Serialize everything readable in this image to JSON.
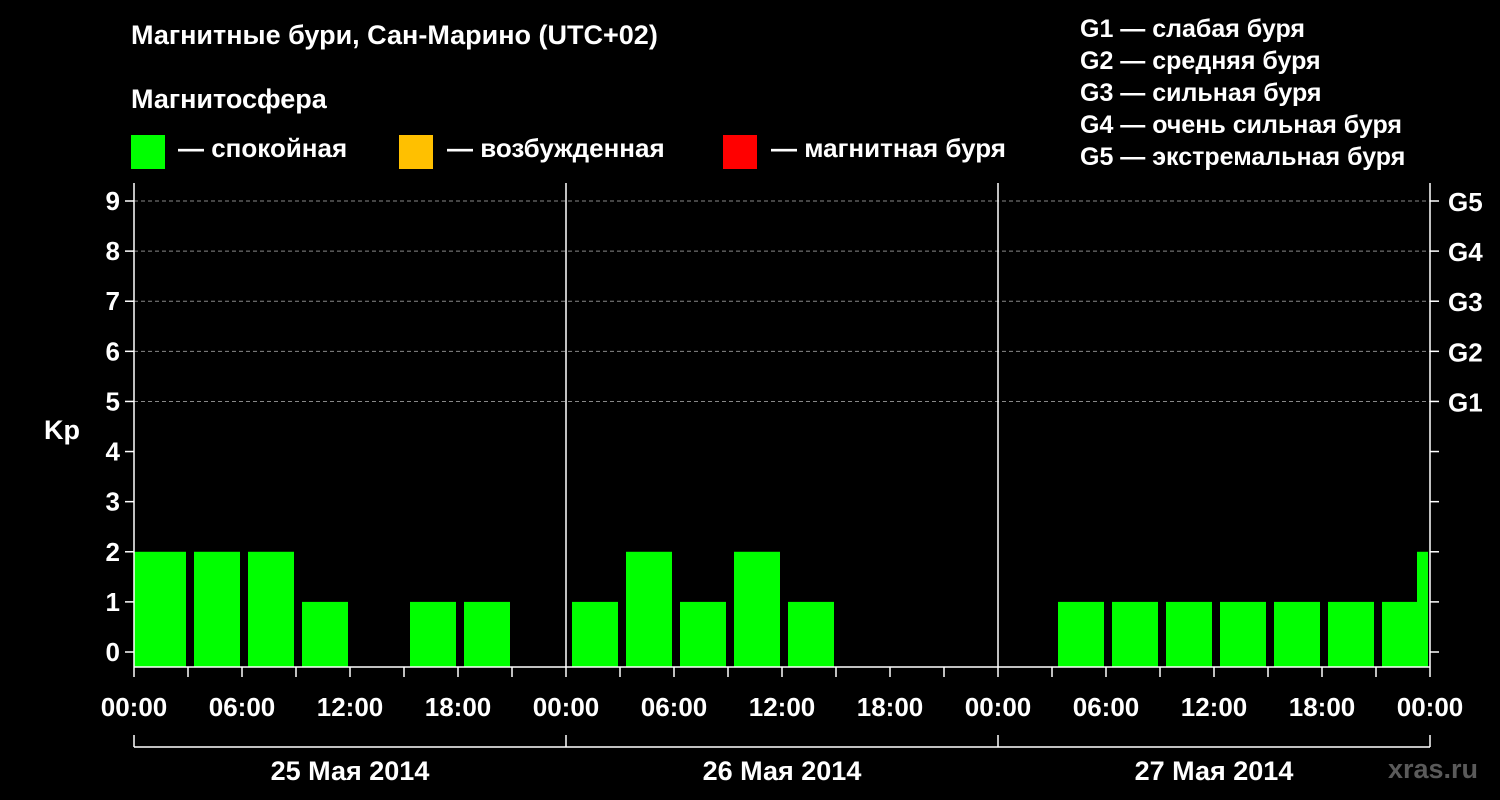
{
  "header": {
    "title": "Магнитные бури, Сан-Марино (UTC+02)",
    "magnetosphere_label": "Магнитосфера",
    "watermark": "xras.ru"
  },
  "legend": [
    {
      "label": "— спокойная",
      "color": "#00ff00"
    },
    {
      "label": "— возбужденная",
      "color": "#ffc000"
    },
    {
      "label": "— магнитная буря",
      "color": "#ff0000"
    }
  ],
  "g_scale": [
    "G1 — слабая буря",
    "G2 — средняя буря",
    "G3 — сильная буря",
    "G4 — очень сильная буря",
    "G5 — экстремальная буря"
  ],
  "chart_data": {
    "type": "bar",
    "ylabel": "Kp",
    "ylim": [
      0,
      9
    ],
    "y_ticks": [
      0,
      1,
      2,
      3,
      4,
      5,
      6,
      7,
      8,
      9
    ],
    "right_axis": [
      {
        "kp": 5,
        "label": "G1"
      },
      {
        "kp": 6,
        "label": "G2"
      },
      {
        "kp": 7,
        "label": "G3"
      },
      {
        "kp": 8,
        "label": "G4"
      },
      {
        "kp": 9,
        "label": "G5"
      }
    ],
    "x_tick_labels": [
      "00:00",
      "06:00",
      "12:00",
      "18:00",
      "00:00",
      "06:00",
      "12:00",
      "18:00",
      "00:00",
      "06:00",
      "12:00",
      "18:00",
      "00:00"
    ],
    "days": [
      "25 Мая 2014",
      "26 Мая 2014",
      "27 Мая 2014"
    ],
    "grid": "horizontal dashed lines at Kp 5-9",
    "interval_hours": 3,
    "bars": [
      {
        "start_hour": 0,
        "kp": 2
      },
      {
        "start_hour": 3,
        "kp": 2
      },
      {
        "start_hour": 6,
        "kp": 2
      },
      {
        "start_hour": 9,
        "kp": 1
      },
      {
        "start_hour": 12,
        "kp": 0
      },
      {
        "start_hour": 15,
        "kp": 1
      },
      {
        "start_hour": 18,
        "kp": 1
      },
      {
        "start_hour": 21,
        "kp": 0
      },
      {
        "start_hour": 24,
        "kp": 1
      },
      {
        "start_hour": 27,
        "kp": 2
      },
      {
        "start_hour": 30,
        "kp": 1
      },
      {
        "start_hour": 33,
        "kp": 2
      },
      {
        "start_hour": 36,
        "kp": 1
      },
      {
        "start_hour": 39,
        "kp": 0
      },
      {
        "start_hour": 42,
        "kp": 0
      },
      {
        "start_hour": 45,
        "kp": 0
      },
      {
        "start_hour": 48,
        "kp": 0
      },
      {
        "start_hour": 51,
        "kp": 1
      },
      {
        "start_hour": 54,
        "kp": 1
      },
      {
        "start_hour": 57,
        "kp": 1
      },
      {
        "start_hour": 60,
        "kp": 1
      },
      {
        "start_hour": 63,
        "kp": 1
      },
      {
        "start_hour": 66,
        "kp": 1
      },
      {
        "start_hour": 69,
        "kp": 1
      },
      {
        "start_hour": 72,
        "kp": 2
      }
    ],
    "bar_color": "#00ff00"
  }
}
